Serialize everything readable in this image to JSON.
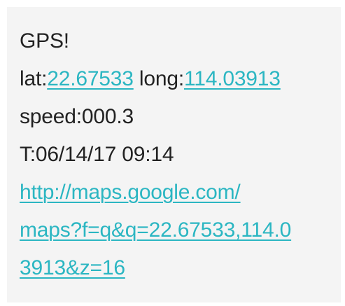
{
  "message": {
    "header": "GPS!",
    "lat_label": "lat:",
    "lat_value": "22.67533",
    "long_label": " long:",
    "long_value": "114.03913",
    "speed": "speed:000.3",
    "time": "T:06/14/17 09:14",
    "url_line1": "http://maps.google.com/",
    "url_line2": "maps?f=q&q=22.67533,114.0",
    "url_line3": "3913&z=16"
  },
  "colors": {
    "text": "#222222",
    "link": "#2bb6c2",
    "background": "#f4f4f4"
  }
}
